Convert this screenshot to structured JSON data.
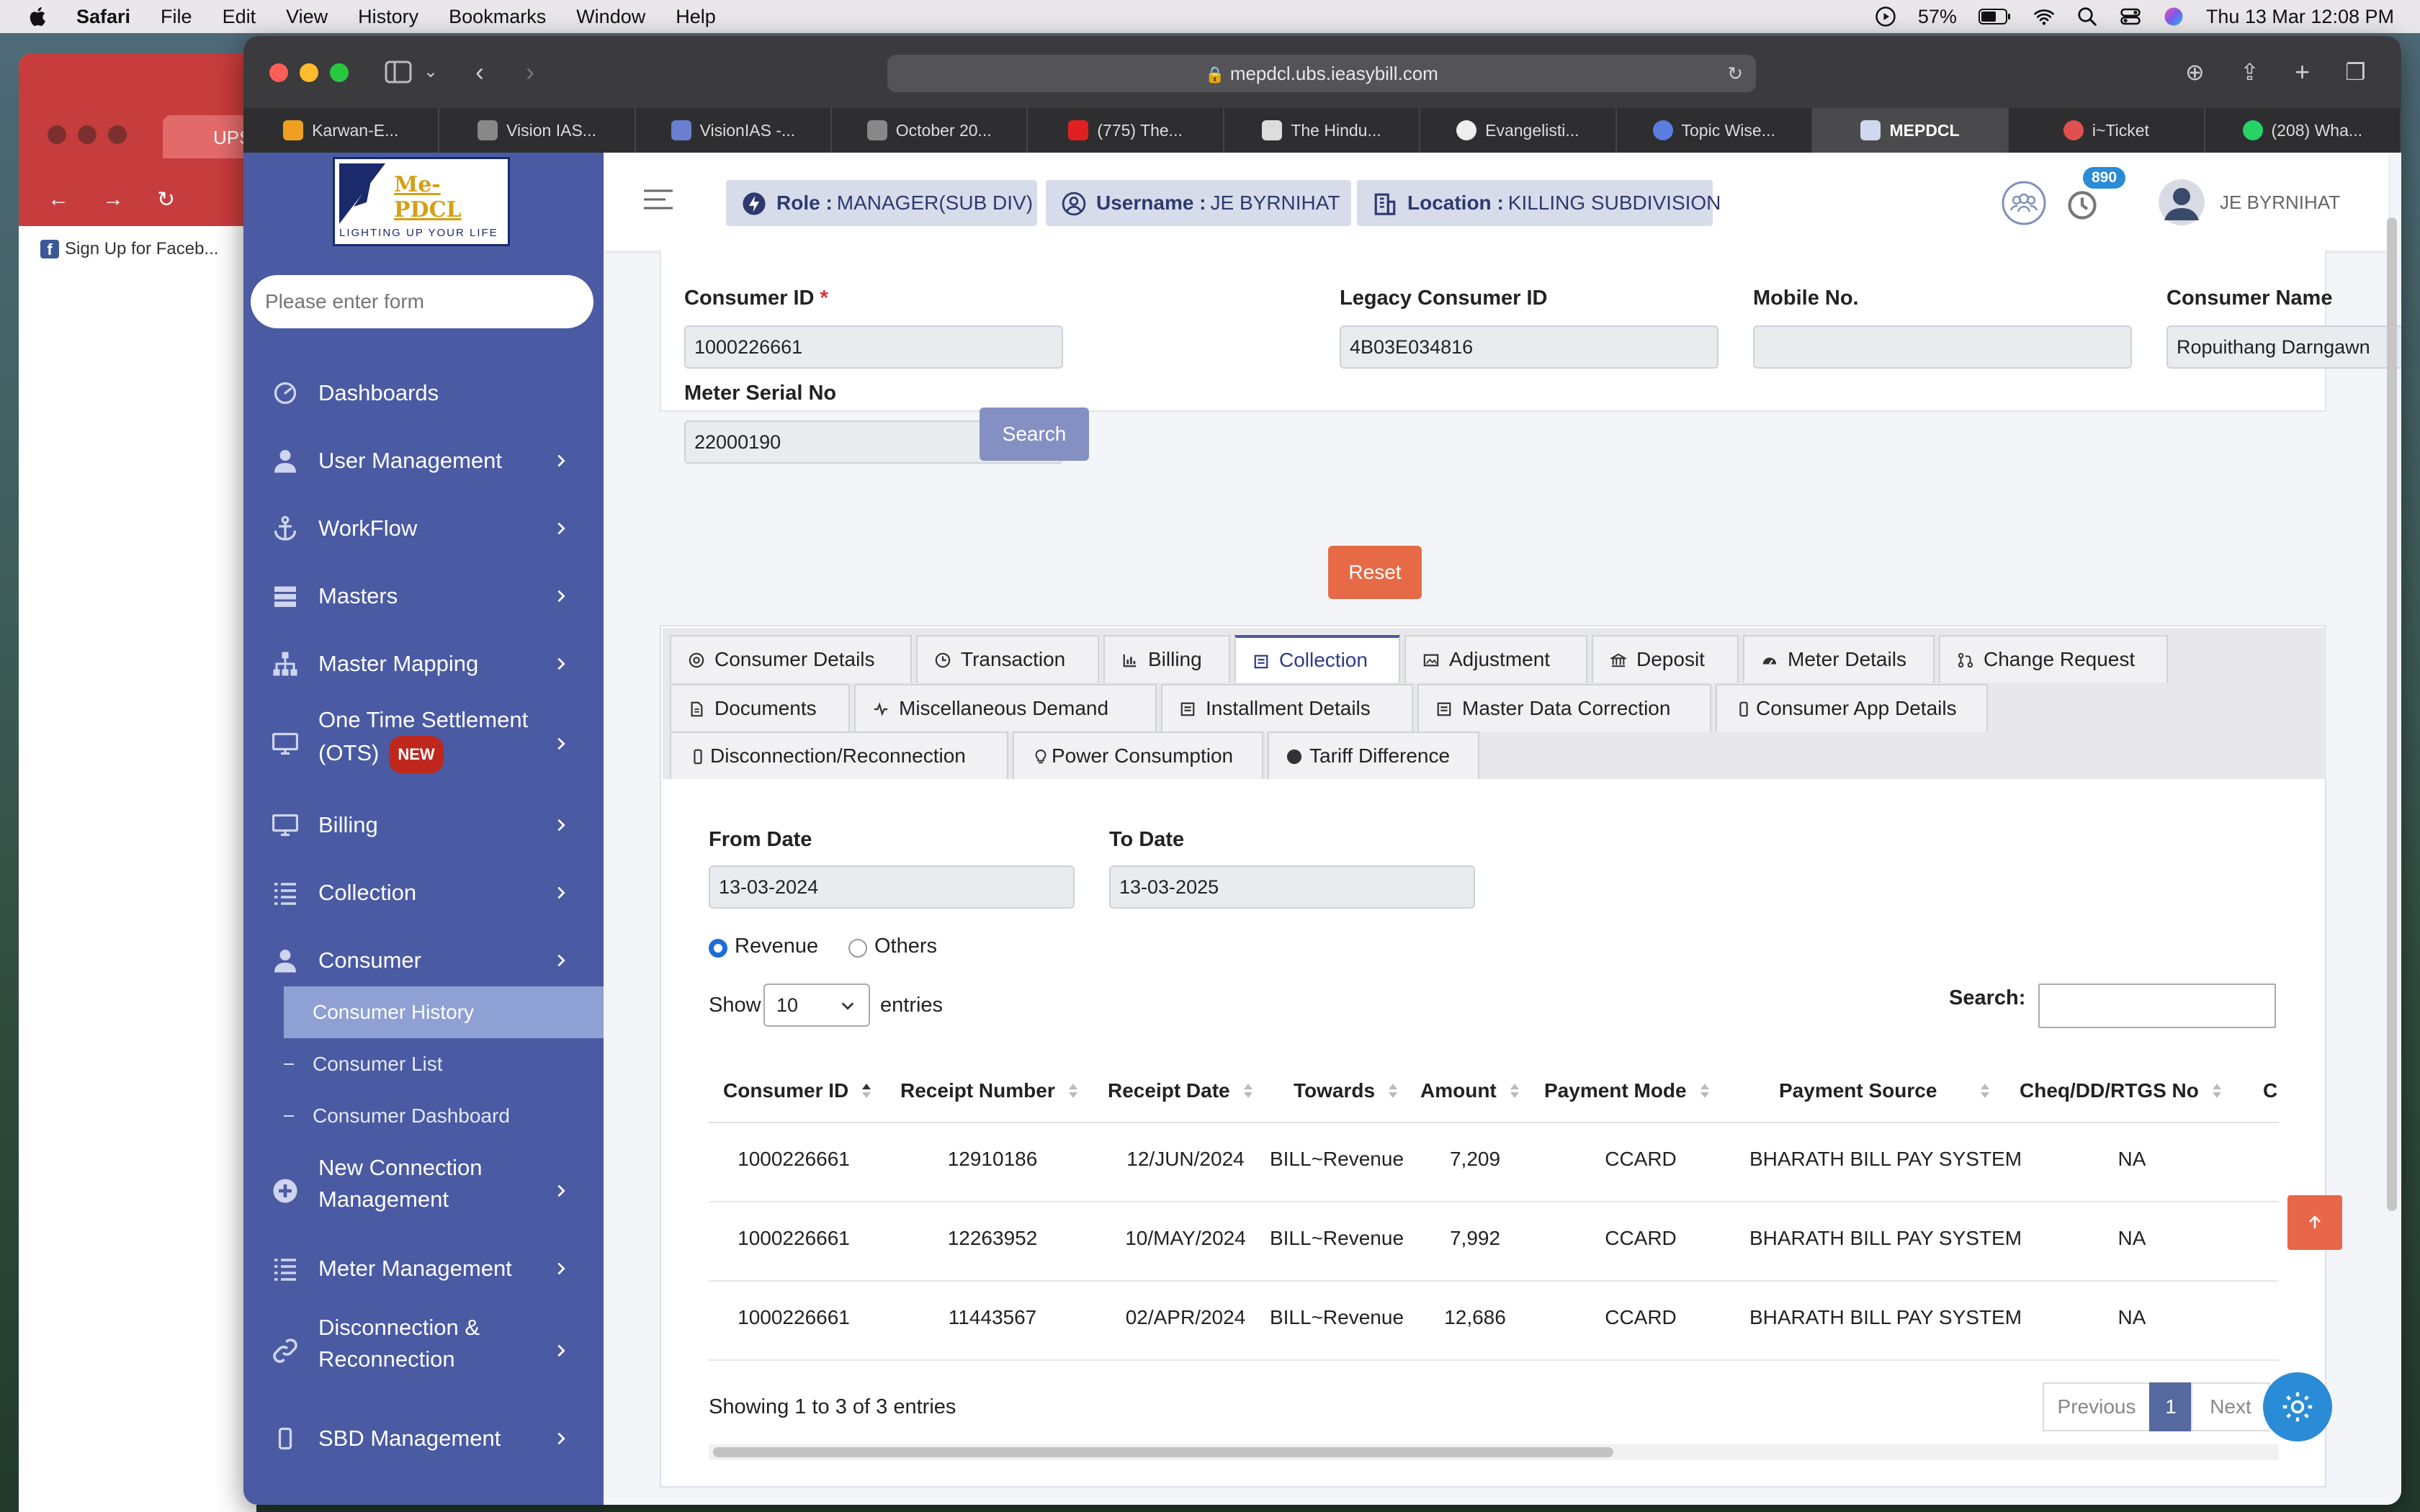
{
  "menubar": {
    "app": "Safari",
    "items": [
      "File",
      "Edit",
      "View",
      "History",
      "Bookmarks",
      "Window",
      "Help"
    ],
    "battery": "57%",
    "datetime": "Thu 13 Mar  12:08 PM"
  },
  "background_window": {
    "tab_title": "UPSC",
    "bookmark": "Sign Up for Faceb..."
  },
  "browser": {
    "url": "mepdcl.ubs.ieasybill.com",
    "tabs": [
      {
        "label": "Karwan-E...",
        "color": "#f0a020"
      },
      {
        "label": "Vision IAS...",
        "color": "#888888"
      },
      {
        "label": "VisionIAS -...",
        "color": "#6b7fd0"
      },
      {
        "label": "October 20...",
        "color": "#888888"
      },
      {
        "label": "(775) The...",
        "color": "#e02020"
      },
      {
        "label": "The Hindu...",
        "color": "#dddddd"
      },
      {
        "label": "Evangelisti...",
        "color": "#eeeeee"
      },
      {
        "label": "Topic Wise...",
        "color": "#5a7de0"
      },
      {
        "label": "MEPDCL",
        "color": "#cfd8ef"
      },
      {
        "label": "i~Ticket",
        "color": "#e05050"
      },
      {
        "label": "(208) Wha...",
        "color": "#25d366"
      }
    ],
    "active_tab": 8
  },
  "sidebar": {
    "logo_text": "Me-PDCL",
    "logo_tagline": "LIGHTING UP YOUR LIFE",
    "search_placeholder": "Please enter form",
    "items": [
      {
        "label": "Dashboards",
        "icon": "speedometer-icon"
      },
      {
        "label": "User Management",
        "icon": "user-icon"
      },
      {
        "label": "WorkFlow",
        "icon": "anchor-icon"
      },
      {
        "label": "Masters",
        "icon": "stack-icon"
      },
      {
        "label": "Master Mapping",
        "icon": "sitemap-icon"
      },
      {
        "label": "One Time Settlement",
        "label2": "(OTS)",
        "badge": "NEW",
        "icon": "monitor-icon"
      },
      {
        "label": "Billing",
        "icon": "monitor-icon"
      },
      {
        "label": "Collection",
        "icon": "list-icon"
      },
      {
        "label": "Consumer",
        "icon": "user-icon"
      },
      {
        "label": "New Connection",
        "label2": "Management",
        "icon": "plus-circle-icon"
      },
      {
        "label": "Meter Management",
        "icon": "list-icon"
      },
      {
        "label": "Disconnection &",
        "label2": "Reconnection",
        "icon": "link-icon"
      },
      {
        "label": "SBD Management",
        "icon": "phone-icon"
      }
    ],
    "consumer_sub": [
      "Consumer History",
      "Consumer List",
      "Consumer Dashboard"
    ]
  },
  "header": {
    "role_label": "Role :",
    "role_value": "MANAGER(SUB DIV)",
    "username_label": "Username :",
    "username_value": "JE BYRNIHAT",
    "location_label": "Location :",
    "location_value": "KILLING SUBDIVISION",
    "notification_count": "890",
    "user_name": "JE BYRNIHAT"
  },
  "form": {
    "consumer_id_label": "Consumer ID",
    "consumer_id_required": "*",
    "consumer_id": "1000226661",
    "legacy_label": "Legacy Consumer ID",
    "legacy_id": "4B03E034816",
    "mobile_label": "Mobile No.",
    "mobile": "",
    "name_label": "Consumer Name",
    "name": "Ropuithang Darngawn",
    "meter_label": "Meter Serial No",
    "meter": "22000190",
    "search_btn": "Search",
    "reset_btn": "Reset"
  },
  "tabs": [
    {
      "label": "Consumer Details",
      "icon": "target-icon"
    },
    {
      "label": "Transaction",
      "icon": "clock-icon"
    },
    {
      "label": "Billing",
      "icon": "chart-icon"
    },
    {
      "label": "Collection",
      "icon": "box-icon"
    },
    {
      "label": "Adjustment",
      "icon": "image-icon"
    },
    {
      "label": "Deposit",
      "icon": "bank-icon"
    },
    {
      "label": "Meter Details",
      "icon": "gauge-icon"
    },
    {
      "label": "Change Request",
      "icon": "pull-request-icon"
    },
    {
      "label": "Documents",
      "icon": "document-icon"
    },
    {
      "label": "Miscellaneous Demand",
      "icon": "pulse-icon"
    },
    {
      "label": "Installment Details",
      "icon": "box-icon"
    },
    {
      "label": "Master Data Correction",
      "icon": "box-icon"
    },
    {
      "label": "Consumer App Details",
      "icon": "mobile-icon"
    },
    {
      "label": "Disconnection/Reconnection",
      "icon": "mobile-icon"
    },
    {
      "label": "Power Consumption",
      "icon": "bulb-icon"
    },
    {
      "label": "Tariff Difference",
      "icon": "dot-icon"
    }
  ],
  "active_tab": "Collection",
  "collection": {
    "from_label": "From Date",
    "from_date": "13-03-2024",
    "to_label": "To Date",
    "to_date": "13-03-2025",
    "radio_revenue": "Revenue",
    "radio_others": "Others",
    "show_label": "Show",
    "entries_value": "10",
    "entries_label": "entries",
    "search_label": "Search:",
    "columns": [
      "Consumer ID",
      "Receipt Number",
      "Receipt Date",
      "Towards",
      "Amount",
      "Payment Mode",
      "Payment Source",
      "Cheq/DD/RTGS No",
      "C"
    ],
    "rows": [
      [
        "1000226661",
        "12910186",
        "12/JUN/2024",
        "BILL~Revenue",
        "7,209",
        "CCARD",
        "BHARATH BILL PAY SYSTEM",
        "NA"
      ],
      [
        "1000226661",
        "12263952",
        "10/MAY/2024",
        "BILL~Revenue",
        "7,992",
        "CCARD",
        "BHARATH BILL PAY SYSTEM",
        "NA"
      ],
      [
        "1000226661",
        "11443567",
        "02/APR/2024",
        "BILL~Revenue",
        "12,686",
        "CCARD",
        "BHARATH BILL PAY SYSTEM",
        "NA"
      ]
    ],
    "showing": "Showing 1 to 3 of 3 entries",
    "prev": "Previous",
    "page": "1",
    "next": "Next"
  }
}
